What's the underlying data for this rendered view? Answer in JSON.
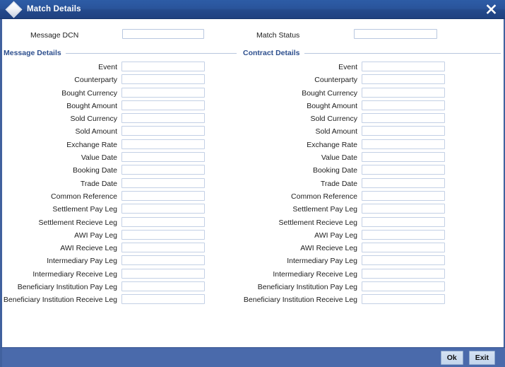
{
  "window": {
    "title": "Match Details",
    "icon": "diamond-icon",
    "close_icon": "close-icon",
    "colors": {
      "titlebar": "#2a549b",
      "footer": "#4a6aab",
      "section_header_text": "#2d4f8e",
      "input_border": "#c3d0e5",
      "frame_border": "#41619e"
    }
  },
  "top_fields": {
    "message_dcn": {
      "label": "Message DCN",
      "value": "",
      "placeholder": ""
    },
    "match_status": {
      "label": "Match Status",
      "value": "",
      "placeholder": ""
    }
  },
  "sections": {
    "message_details": {
      "header": "Message Details",
      "fields": [
        {
          "label": "Event",
          "value": ""
        },
        {
          "label": "Counterparty",
          "value": ""
        },
        {
          "label": "Bought Currency",
          "value": ""
        },
        {
          "label": "Bought Amount",
          "value": ""
        },
        {
          "label": "Sold Currency",
          "value": ""
        },
        {
          "label": "Sold Amount",
          "value": ""
        },
        {
          "label": "Exchange Rate",
          "value": ""
        },
        {
          "label": "Value Date",
          "value": ""
        },
        {
          "label": "Booking Date",
          "value": ""
        },
        {
          "label": "Trade Date",
          "value": ""
        },
        {
          "label": "Common Reference",
          "value": ""
        },
        {
          "label": "Settlement Pay Leg",
          "value": ""
        },
        {
          "label": "Settlement Recieve Leg",
          "value": ""
        },
        {
          "label": "AWI Pay Leg",
          "value": ""
        },
        {
          "label": "AWI Recieve Leg",
          "value": ""
        },
        {
          "label": "Intermediary Pay Leg",
          "value": ""
        },
        {
          "label": "Intermediary Receive Leg",
          "value": ""
        },
        {
          "label": "Beneficiary Institution Pay Leg",
          "value": ""
        },
        {
          "label": "Beneficiary Institution Receive Leg",
          "value": ""
        }
      ]
    },
    "contract_details": {
      "header": "Contract Details",
      "fields": [
        {
          "label": "Event",
          "value": ""
        },
        {
          "label": "Counterparty",
          "value": ""
        },
        {
          "label": "Bought Currency",
          "value": ""
        },
        {
          "label": "Bought Amount",
          "value": ""
        },
        {
          "label": "Sold Currency",
          "value": ""
        },
        {
          "label": "Sold Amount",
          "value": ""
        },
        {
          "label": "Exchange Rate",
          "value": ""
        },
        {
          "label": "Value Date",
          "value": ""
        },
        {
          "label": "Booking Date",
          "value": ""
        },
        {
          "label": "Trade Date",
          "value": ""
        },
        {
          "label": "Common Reference",
          "value": ""
        },
        {
          "label": "Settlement Pay Leg",
          "value": ""
        },
        {
          "label": "Settlement Recieve Leg",
          "value": ""
        },
        {
          "label": "AWI Pay Leg",
          "value": ""
        },
        {
          "label": "AWI Recieve Leg",
          "value": ""
        },
        {
          "label": "Intermediary Pay Leg",
          "value": ""
        },
        {
          "label": "Intermediary Receive Leg",
          "value": ""
        },
        {
          "label": "Beneficiary Institution Pay Leg",
          "value": ""
        },
        {
          "label": "Beneficiary Institution Receive Leg",
          "value": ""
        }
      ]
    }
  },
  "footer": {
    "ok_label": "Ok",
    "exit_label": "Exit"
  }
}
